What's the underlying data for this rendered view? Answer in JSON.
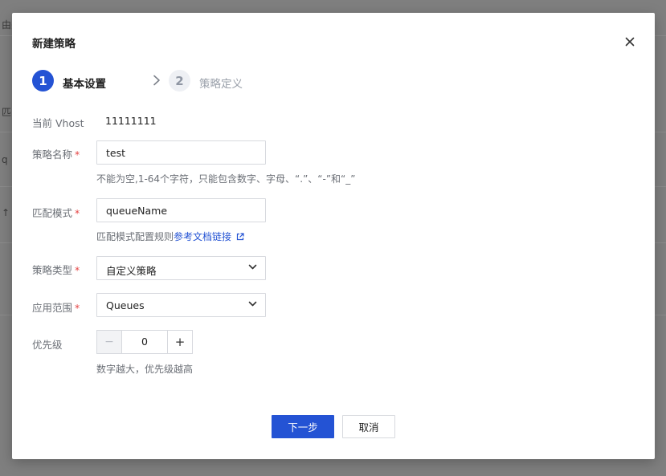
{
  "background": {
    "fragments": [
      "由关",
      "匹",
      "q",
      "↑"
    ]
  },
  "dialog": {
    "title": "新建策略",
    "steps": [
      {
        "number": "1",
        "label": "基本设置",
        "state": "active"
      },
      {
        "number": "2",
        "label": "策略定义",
        "state": "inactive"
      }
    ]
  },
  "form": {
    "vhost": {
      "label": "当前 Vhost",
      "value": "11111111"
    },
    "name": {
      "label": "策略名称",
      "required_mark": "*",
      "value": "test",
      "hint": "不能为空,1-64个字符，只能包含数字、字母、“.”、“-”和“_”"
    },
    "pattern": {
      "label": "匹配模式",
      "required_mark": "*",
      "value": "queueName",
      "hint_prefix": "匹配模式配置规则",
      "hint_link": "参考文档链接"
    },
    "policy_type": {
      "label": "策略类型",
      "required_mark": "*",
      "selected": "自定义策略"
    },
    "apply_to": {
      "label": "应用范围",
      "required_mark": "*",
      "selected": "Queues"
    },
    "priority": {
      "label": "优先级",
      "value": "0",
      "minus": "−",
      "plus": "+",
      "hint": "数字越大，优先级越高"
    }
  },
  "footer": {
    "next_label": "下一步",
    "cancel_label": "取消"
  },
  "colors": {
    "accent": "#2453d4",
    "required": "#e54545",
    "overlay": "#7f7f7f"
  },
  "icons": {
    "close": "close-icon",
    "step_arrow": "chevron-right-icon",
    "select_arrow": "chevron-down-icon",
    "external_link": "external-link-icon"
  }
}
